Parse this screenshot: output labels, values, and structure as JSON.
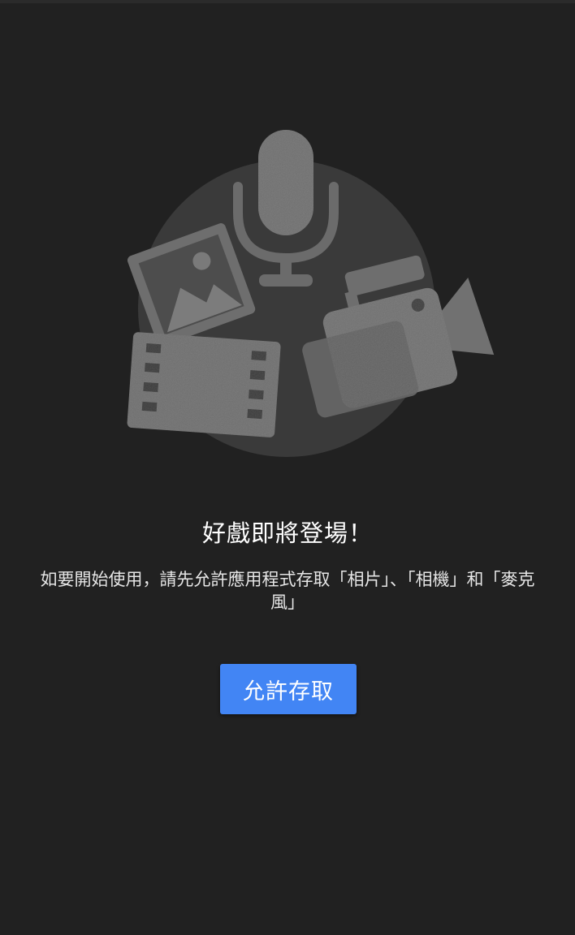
{
  "permission_screen": {
    "title": "好戲即將登場！",
    "message": "如要開始使用，請先允許應用程式存取「相片」、「相機」和「麥克風」",
    "allow_button_label": "允許存取"
  },
  "illustration": {
    "icons": [
      "microphone-icon",
      "photo-icon",
      "film-strip-icon",
      "video-camera-icon"
    ]
  },
  "colors": {
    "background": "#212121",
    "illustration_circle": "#3a3a3a",
    "illustration_icon": "#6e6e6e",
    "button": "#4285f4",
    "title_text": "#ffffff"
  }
}
